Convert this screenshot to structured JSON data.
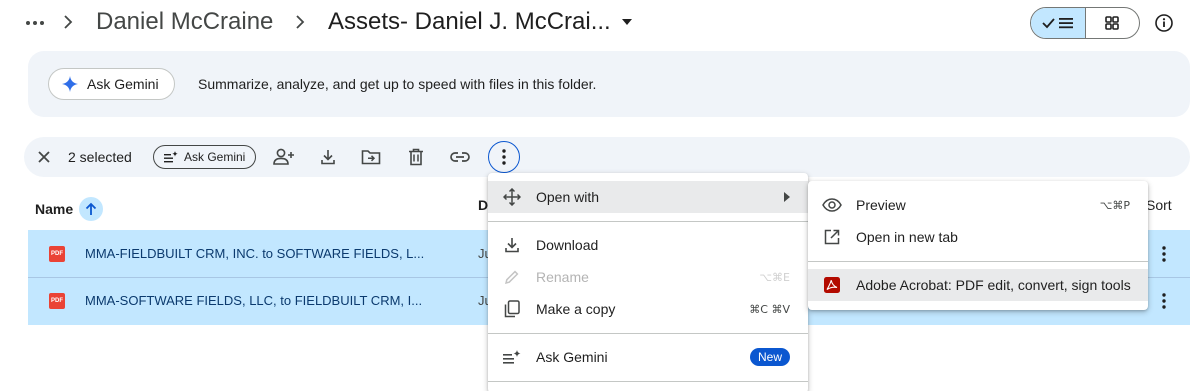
{
  "breadcrumb": {
    "parent": "Daniel McCraine",
    "current": "Assets- Daniel J. McCrai..."
  },
  "banner": {
    "chip_label": "Ask Gemini",
    "text": "Summarize, analyze, and get up to speed with files in this folder."
  },
  "selection": {
    "count_label": "2 selected",
    "gemini_label": "Ask Gemini"
  },
  "table": {
    "headers": {
      "name": "Name",
      "date": "D",
      "sort": "Sort"
    },
    "rows": [
      {
        "icon_label": "PDF",
        "name": "MMA-FIELDBUILT CRM, INC. to SOFTWARE FIELDS, L...",
        "date": "Ju"
      },
      {
        "icon_label": "PDF",
        "name": "MMA-SOFTWARE FIELDS, LLC, to FIELDBUILT CRM, I...",
        "date": "Ju"
      }
    ]
  },
  "context_menu": {
    "open_with": "Open with",
    "download": "Download",
    "rename": "Rename",
    "rename_shortcut": "⌥⌘E",
    "make_copy": "Make a copy",
    "make_copy_shortcut": "⌘C ⌘V",
    "ask_gemini": "Ask Gemini",
    "new_badge": "New"
  },
  "submenu": {
    "preview": "Preview",
    "preview_shortcut": "⌥⌘P",
    "open_new_tab": "Open in new tab",
    "acrobat": "Adobe Acrobat: PDF edit, convert, sign tools"
  },
  "colors": {
    "selected_row": "#c2e7ff",
    "accent": "#0b57d0",
    "banner_bg": "#f0f4f9",
    "pdf_red": "#ea4335"
  }
}
